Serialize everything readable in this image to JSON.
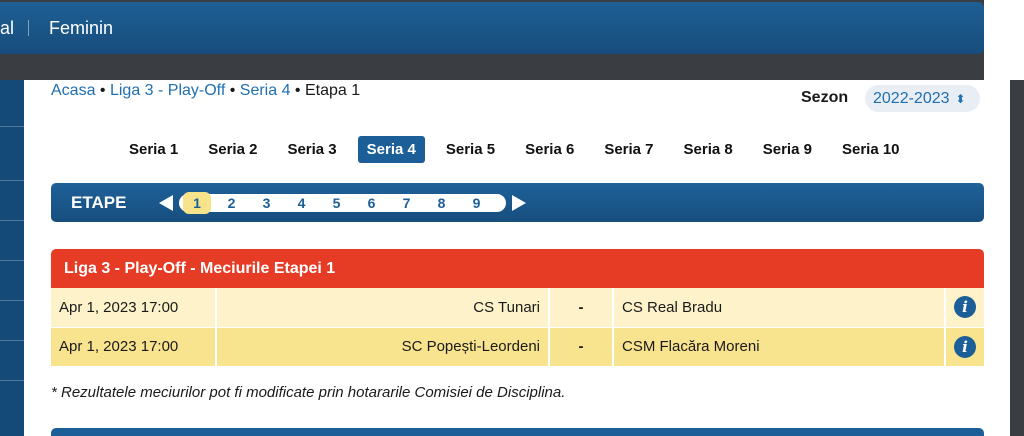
{
  "topnav": {
    "partial_item": "al",
    "item_feminin": "Feminin"
  },
  "breadcrumb": {
    "home": "Acasa",
    "league": "Liga 3 - Play-Off",
    "series": "Seria 4",
    "current": "Etapa 1"
  },
  "season": {
    "label": "Sezon",
    "value": "2022-2023"
  },
  "series_tabs": [
    "Seria 1",
    "Seria 2",
    "Seria 3",
    "Seria 4",
    "Seria 5",
    "Seria 6",
    "Seria 7",
    "Seria 8",
    "Seria 9",
    "Seria 10"
  ],
  "active_series": "Seria 4",
  "etape": {
    "label": "ETAPE",
    "numbers": [
      "1",
      "2",
      "3",
      "4",
      "5",
      "6",
      "7",
      "8",
      "9"
    ],
    "active": "1"
  },
  "results": {
    "title": "Liga 3 - Play-Off - Meciurile Etapei 1",
    "matches": [
      {
        "date": "Apr 1, 2023 17:00",
        "home": "CS Tunari",
        "score": "-",
        "away": "CS Real Bradu"
      },
      {
        "date": "Apr 1, 2023 17:00",
        "home": "SC Popești-Leordeni",
        "score": "-",
        "away": "CSM Flacăra Moreni"
      }
    ]
  },
  "footnote": "* Rezultatele meciurilor pot fi modificate prin hotararile Comisiei de Disciplina.",
  "colors": {
    "nav_blue": "#1c5f98",
    "header_red": "#e63b25",
    "row_light": "#fdf2c9",
    "row_dark": "#f8e38f",
    "link_blue": "#1f6fb2"
  }
}
